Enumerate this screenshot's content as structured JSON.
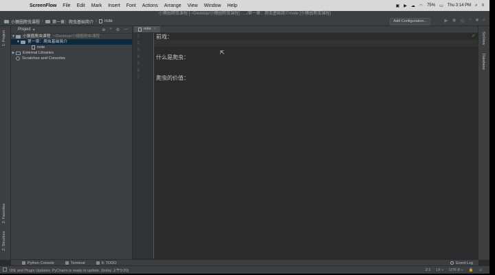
{
  "menubar": {
    "app": "ScreenFlow",
    "items": [
      "File",
      "Edit",
      "Mark",
      "Insert",
      "Font",
      "Actions",
      "Arrange",
      "View",
      "Window",
      "Help"
    ],
    "battery": "75%",
    "time": "Thu 3:14 PM"
  },
  "window_title": "小猿圈爬虫课程 [~/Desktop/小猿圈爬虫课程] - .../第一章：爬虫基础简介/note [小猿圈爬虫课程]",
  "breadcrumb": [
    "小猿圈爬虫课程",
    "第一章：爬虫基础简介",
    "note"
  ],
  "run_config": "Add Configuration...",
  "project_panel": {
    "title": "Project",
    "root": "小猿圈爬虫课程",
    "root_path": "~/Desktop/小猿圈爬虫课程",
    "folder": "第一章：爬虫基础简介",
    "file": "note",
    "external": "External Libraries",
    "scratches": "Scratches and Consoles"
  },
  "left_tabs": {
    "project": "1: Project",
    "favorites": "2: Favorites",
    "structure": "Z: Structure"
  },
  "right_tabs": {
    "sciview": "SciView",
    "database": "Database"
  },
  "editor_tab": "note",
  "line_numbers": [
    "1",
    "2",
    "3",
    "4",
    "5",
    "6",
    "7"
  ],
  "code_lines": {
    "l1": "前戏：",
    "l4": "什么是爬虫：",
    "l7": "爬虫的价值："
  },
  "bottom_tabs": {
    "console": "Python Console",
    "terminal": "Terminal",
    "todo": "6: TODO",
    "eventlog": "Event Log"
  },
  "status": {
    "message": "IDE and Plugin Updates: PyCharm is ready to update. (today 上午9:20)",
    "position": "2:1",
    "line_sep": "LF ÷",
    "encoding": "UTF-8 ÷"
  }
}
